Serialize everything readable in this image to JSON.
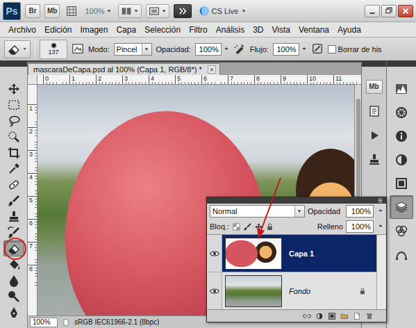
{
  "app": {
    "logo": "Ps",
    "bridge": "Br",
    "mini_bridge": "Mb",
    "zoom": "100%",
    "cs_live": "CS Live"
  },
  "menu": [
    "Archivo",
    "Edición",
    "Imagen",
    "Capa",
    "Selección",
    "Filtro",
    "Análisis",
    "3D",
    "Vista",
    "Ventana",
    "Ayuda"
  ],
  "options": {
    "brush_size": "137",
    "mode_label": "Modo:",
    "mode": "Pincel",
    "opacity_label": "Opacidad:",
    "opacity": "100%",
    "flow_label": "Flujo:",
    "flow": "100%",
    "erase_history": {
      "label": "Borrar de his",
      "checked": false
    }
  },
  "tools": [
    {
      "kind": "move",
      "selected": false
    },
    {
      "kind": "marquee",
      "selected": false
    },
    {
      "kind": "lasso",
      "selected": false
    },
    {
      "kind": "quick-select",
      "selected": false
    },
    {
      "kind": "crop",
      "selected": false
    },
    {
      "kind": "eyedropper",
      "selected": false
    },
    {
      "kind": "healing",
      "selected": false
    },
    {
      "kind": "brush",
      "selected": false
    },
    {
      "kind": "stamp",
      "selected": false
    },
    {
      "kind": "history-brush",
      "selected": false
    },
    {
      "kind": "eraser",
      "selected": true
    },
    {
      "kind": "bucket",
      "selected": false
    },
    {
      "kind": "blur",
      "selected": false
    },
    {
      "kind": "dodge",
      "selected": false
    },
    {
      "kind": "pen",
      "selected": false
    }
  ],
  "document": {
    "tab": "mascaraDeCapa.psd al 100% (Capa 1, RGB/8*) *",
    "close": "×"
  },
  "rulers": {
    "horizontal": [
      "0",
      "1",
      "2",
      "3",
      "4",
      "5",
      "6",
      "7",
      "8",
      "9",
      "10",
      "11"
    ],
    "vertical": [
      "1",
      "2",
      "3",
      "4",
      "5",
      "6",
      "7",
      "8"
    ]
  },
  "status_bar": {
    "zoom": "100%",
    "profile": "sRGB IEC61966-2.1 (8bpc)"
  },
  "dock_left": {
    "mini_bridge": "Mb",
    "items": [
      {
        "kind": "history"
      },
      {
        "kind": "actions"
      },
      {
        "kind": "clone-source"
      }
    ]
  },
  "dock_right": {
    "items": [
      {
        "kind": "histogram",
        "selected": false
      },
      {
        "kind": "navigator",
        "selected": false
      },
      {
        "kind": "info",
        "selected": false
      },
      {
        "kind": "adjustments",
        "selected": false
      },
      {
        "kind": "masks",
        "selected": false
      },
      {
        "kind": "layers",
        "selected": true
      },
      {
        "kind": "channels",
        "selected": false
      },
      {
        "kind": "paths",
        "selected": false
      }
    ]
  },
  "layers_panel": {
    "blend_mode": "Normal",
    "opacity_label": "Opacidad",
    "opacity": "100%",
    "lock_label": "Bloq.:",
    "fill_label": "Relleno",
    "fill": "100%",
    "layers": [
      {
        "name": "Capa 1",
        "selected": true,
        "visible": true,
        "locked": false
      },
      {
        "name": "Fondo",
        "selected": false,
        "visible": true,
        "locked": true
      }
    ]
  }
}
